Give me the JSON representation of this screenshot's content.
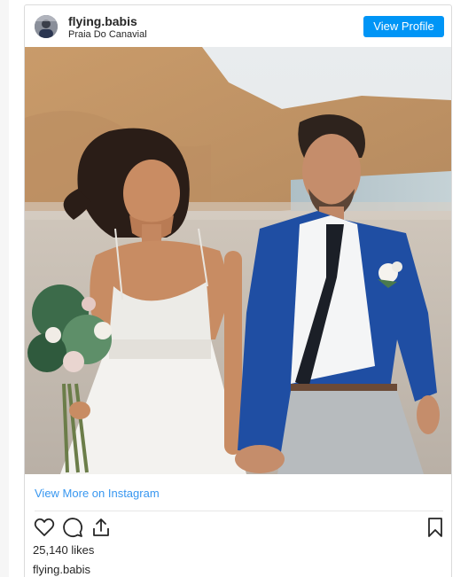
{
  "header": {
    "username": "flying.babis",
    "location": "Praia Do Canavial",
    "view_profile_label": "View Profile",
    "accent_color": "#0095f6"
  },
  "post": {
    "view_more_label": "View More on Instagram",
    "likes_label": "25,140 likes",
    "caption_username": "flying.babis"
  },
  "actions": {
    "icons": [
      "heart-icon",
      "comment-icon",
      "share-icon",
      "bookmark-icon"
    ]
  }
}
